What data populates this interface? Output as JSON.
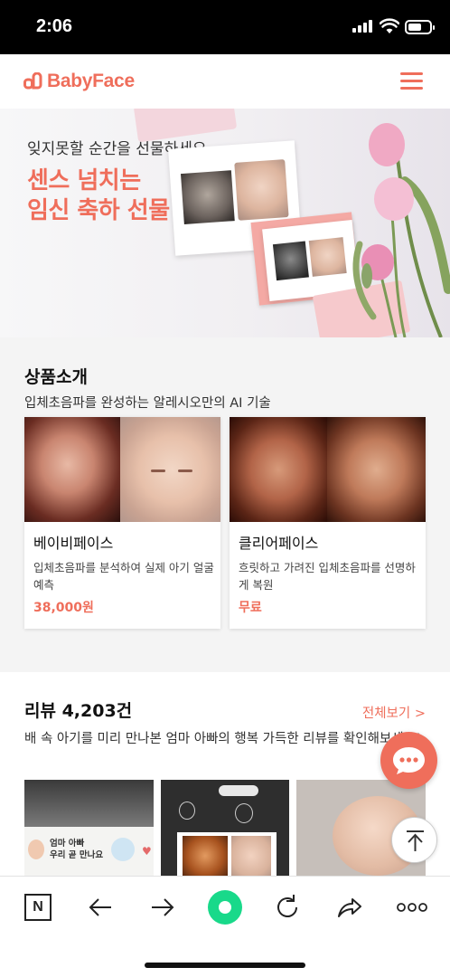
{
  "status": {
    "time": "2:06"
  },
  "header": {
    "logo_text": "BabyFace"
  },
  "hero": {
    "subtitle": "잊지못할 순간을 선물하세요",
    "title_line1": "센스 넘치는",
    "title_line2": "임신 축하 선물"
  },
  "products": {
    "title": "상품소개",
    "subtitle": "입체초음파를 완성하는 알레시오만의 AI 기술",
    "items": [
      {
        "name": "베이비페이스",
        "desc": "입체초음파를 분석하여 실제 아기 얼굴 예측",
        "price": "38,000원"
      },
      {
        "name": "클리어페이스",
        "desc": "흐릿하고 가려진 입체초음파를 선명하게 복원",
        "price": "무료"
      }
    ]
  },
  "reviews": {
    "title": "리뷰 4,203건",
    "view_all": "전체보기 >",
    "description": "배 속 아기를 미리 만나본 엄마 아빠의 행복 가득한 리뷰를 확인해보세요!",
    "card1_text_line1": "엄마 아빠",
    "card1_text_line2": "우리 곧 만나요"
  },
  "colors": {
    "accent": "#ef6e5b",
    "toolbar_green": "#19d98a"
  },
  "toolbar": {
    "icons": [
      "naver-icon",
      "back-arrow-icon",
      "forward-arrow-icon",
      "home-dot-icon",
      "refresh-icon",
      "share-icon",
      "more-icon"
    ],
    "naver_label": "N"
  }
}
